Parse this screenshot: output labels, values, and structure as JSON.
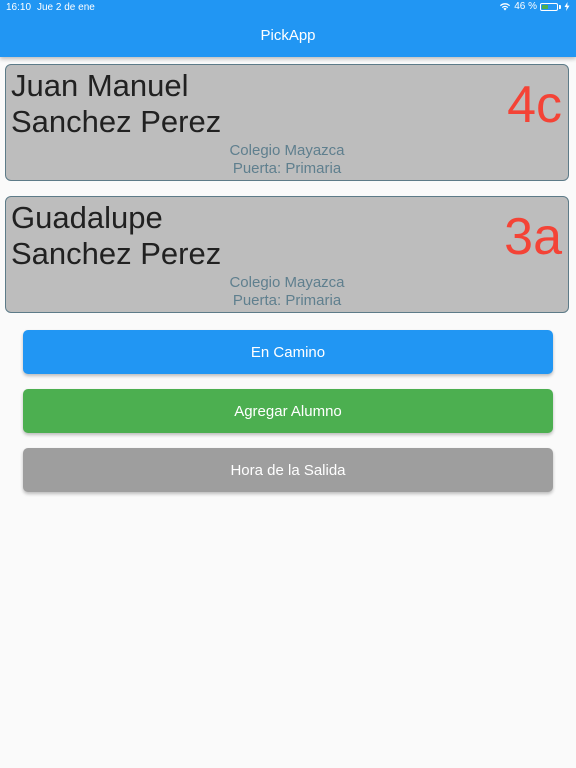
{
  "status_bar": {
    "time": "16:10",
    "date": "Jue 2 de ene",
    "battery_text": "46 %",
    "battery_level": 0.46,
    "wifi_icon": "wifi-icon",
    "charging_icon": "bolt-icon"
  },
  "app_bar": {
    "title": "PickApp"
  },
  "students": [
    {
      "name": "Juan Manuel\nSanchez Perez",
      "grade": "4c",
      "school": "Colegio Mayazca",
      "gate": "Puerta: Primaria"
    },
    {
      "name": "Guadalupe\nSanchez Perez",
      "grade": "3a",
      "school": "Colegio Mayazca",
      "gate": "Puerta: Primaria"
    }
  ],
  "buttons": {
    "on_way": "En Camino",
    "add_student": "Agregar Alumno",
    "departure_time": "Hora de la Salida"
  },
  "colors": {
    "primary": "#2196f3",
    "success": "#4caf50",
    "neutral": "#9e9e9e",
    "grade_accent": "#f44336"
  }
}
